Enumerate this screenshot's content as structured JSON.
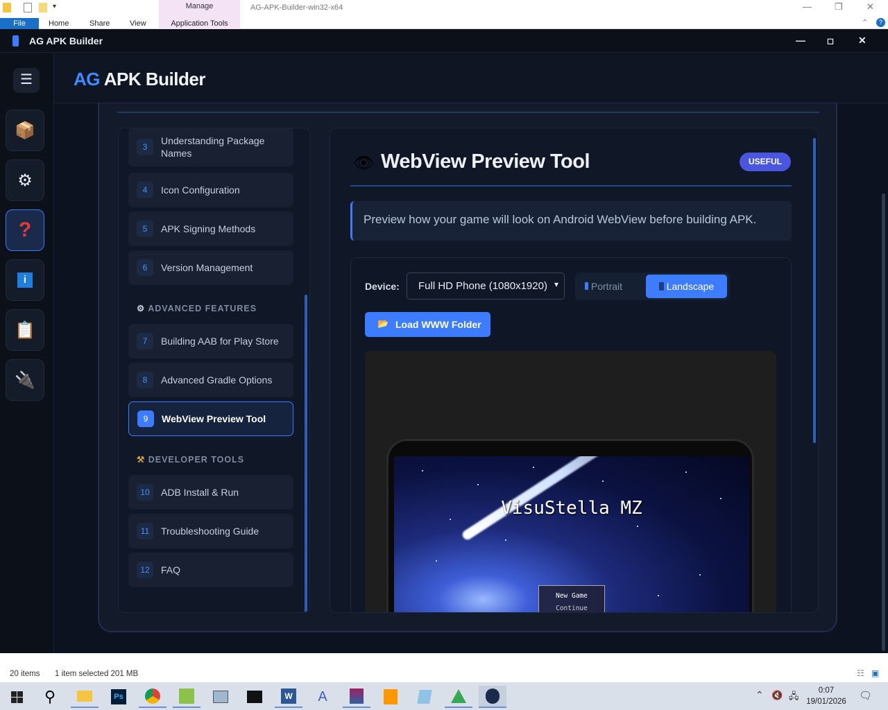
{
  "explorer": {
    "tabs": {
      "file": "File",
      "home": "Home",
      "share": "Share",
      "view": "View",
      "manage": "Manage",
      "app_tools": "Application Tools"
    },
    "title": "AG-APK-Builder-win32-x64",
    "status": {
      "items": "20 items",
      "selected": "1 item selected  201 MB"
    }
  },
  "app": {
    "window_title": "AG APK Builder",
    "brand_prefix": "AG",
    "brand_suffix": " APK Builder",
    "rail": [
      "package-icon",
      "gear-icon",
      "help-icon",
      "info-icon",
      "clipboard-icon",
      "plug-icon"
    ],
    "toc": {
      "items": [
        {
          "num": "3",
          "label": "Understanding Package Names"
        },
        {
          "num": "4",
          "label": "Icon Configuration"
        },
        {
          "num": "5",
          "label": "APK Signing Methods"
        },
        {
          "num": "6",
          "label": "Version Management"
        },
        {
          "num": "7",
          "label": "Building AAB for Play Store"
        },
        {
          "num": "8",
          "label": "Advanced Gradle Options"
        },
        {
          "num": "9",
          "label": "WebView Preview Tool"
        },
        {
          "num": "10",
          "label": "ADB Install & Run"
        },
        {
          "num": "11",
          "label": "Troubleshooting Guide"
        },
        {
          "num": "12",
          "label": "FAQ"
        }
      ],
      "section_advanced": "ADVANCED FEATURES",
      "section_dev": "DEVELOPER TOOLS"
    },
    "content": {
      "title": "WebView Preview Tool",
      "badge": "USEFUL",
      "description": "Preview how your game will look on Android WebView before building APK.",
      "device_label": "Device:",
      "device_value": "Full HD Phone (1080x1920)",
      "portrait": "Portrait",
      "landscape": "Landscape",
      "load_button": "Load WWW Folder",
      "game_title": "VisuStella MZ",
      "menu_new": "New Game",
      "menu_continue": "Continue"
    }
  },
  "taskbar": {
    "time": "0:07",
    "date": "19/01/2026"
  },
  "colors": {
    "accent": "#3d7bff",
    "badge": "#4a55e0",
    "bg": "#0c1220"
  }
}
